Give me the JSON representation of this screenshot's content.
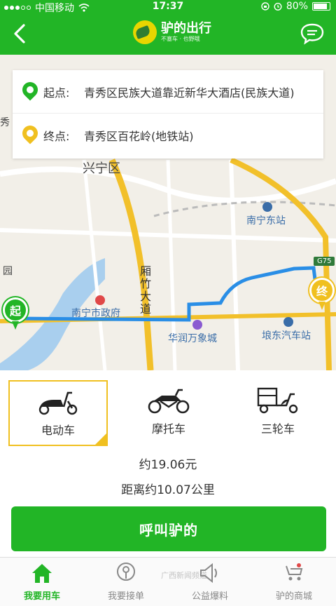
{
  "status_bar": {
    "carrier": "中国移动",
    "time": "17:37",
    "battery": "80%"
  },
  "header": {
    "app_name": "驴的出行",
    "slogan": "不塞车 · 也野哦"
  },
  "route": {
    "start_label": "起点:",
    "start_value": "青秀区民族大道靠近新华大酒店(民族大道)",
    "end_label": "终点:",
    "end_value": "青秀区百花岭(地铁站)"
  },
  "map": {
    "labels": {
      "nanning_east": "南宁东站",
      "gov": "南宁市政府",
      "xiangzhu": "厢竹大道",
      "wanxiang": "华润万象城",
      "bus_station": "埌东汽车站",
      "xiu": "秀",
      "yuan": "园",
      "district": "兴宁区",
      "highway": "G75"
    },
    "start_marker": "起",
    "end_marker": "终",
    "colors": {
      "route": "#2a8ee6",
      "road_major": "#f2c02a",
      "start": "#22b526",
      "end": "#f0c020"
    }
  },
  "vehicles": [
    {
      "label": "电动车",
      "icon": "scooter-icon",
      "selected": true
    },
    {
      "label": "摩托车",
      "icon": "motorcycle-icon",
      "selected": false
    },
    {
      "label": "三轮车",
      "icon": "tricycle-icon",
      "selected": false
    }
  ],
  "price_text": "约19.06元",
  "distance_text": "距离约10.07公里",
  "call_button": "呼叫驴的",
  "tabs": [
    {
      "label": "我要用车",
      "icon": "home-icon",
      "active": true
    },
    {
      "label": "我要接单",
      "icon": "order-icon",
      "active": false
    },
    {
      "label": "公益爆料",
      "icon": "speaker-icon",
      "active": false
    },
    {
      "label": "驴的商城",
      "icon": "mall-icon",
      "active": false
    }
  ],
  "watermark": "广西新闻频道",
  "accent": "#22b526"
}
